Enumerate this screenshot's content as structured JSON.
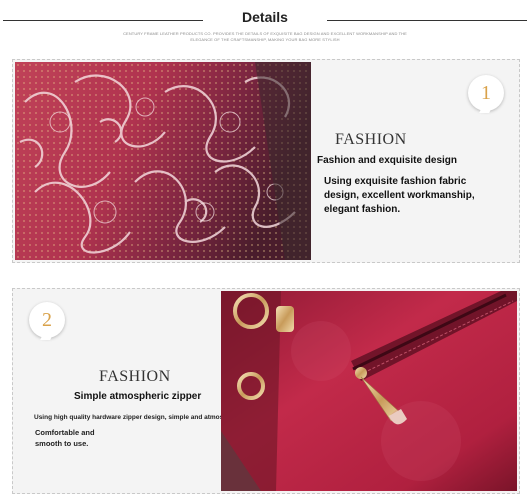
{
  "header": {
    "title": "Details",
    "subtitle": "CENTURY FRAME LEATHER PRODUCTS CO. PROVIDES THE DETAILS OF EXQUISITE BAG DESIGN AND EXCELLENT WORKMANSHIP AND THE ELEGANCE OF THE CRAFTSMANSHIP, MAKING YOUR BAG MORE STYLISH"
  },
  "sections": [
    {
      "number": "1",
      "label": "FASHION",
      "heading": "Fashion and exquisite design",
      "text": "Using exquisite fashion fabric design, excellent workmanship, elegant fashion."
    },
    {
      "number": "2",
      "label": "FASHION",
      "heading": "Simple atmospheric zipper",
      "text": "Using high quality hardware zipper design, simple and atmospheric,",
      "text2": "Comfortable and smooth to use."
    }
  ],
  "colors": {
    "badge_number": "#d9a24a",
    "panel_bg": "#f4f4f4",
    "leather": "#b2203f"
  }
}
